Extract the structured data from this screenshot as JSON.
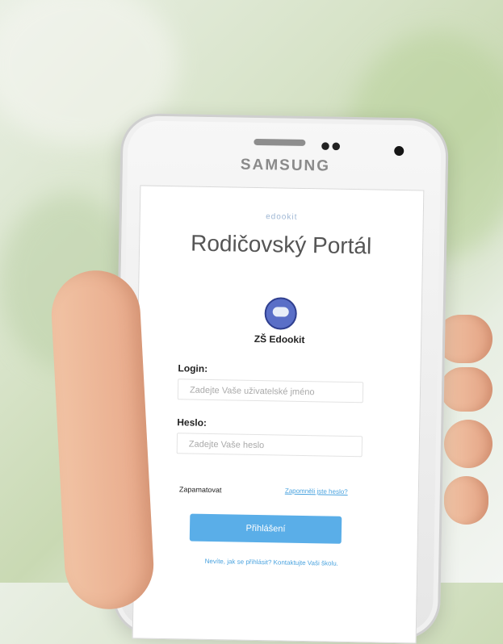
{
  "phone": {
    "brand": "SAMSUNG"
  },
  "app": {
    "logo_small": "edookit",
    "title": "Rodičovský Portál",
    "school_name": "ZŠ Edookit",
    "login_label": "Login:",
    "login_placeholder": "Zadejte Vaše uživatelské jméno",
    "password_label": "Heslo:",
    "password_placeholder": "Zadejte Vaše heslo",
    "remember_label": "Zapamatovat",
    "forgot_link": "Zapomněli jste heslo?",
    "login_button": "Přihlášení",
    "help_note": "Nevíte, jak se přihlásit? Kontaktujte Vaši školu."
  },
  "colors": {
    "button": "#5aaee8",
    "link": "#4aa3df"
  }
}
